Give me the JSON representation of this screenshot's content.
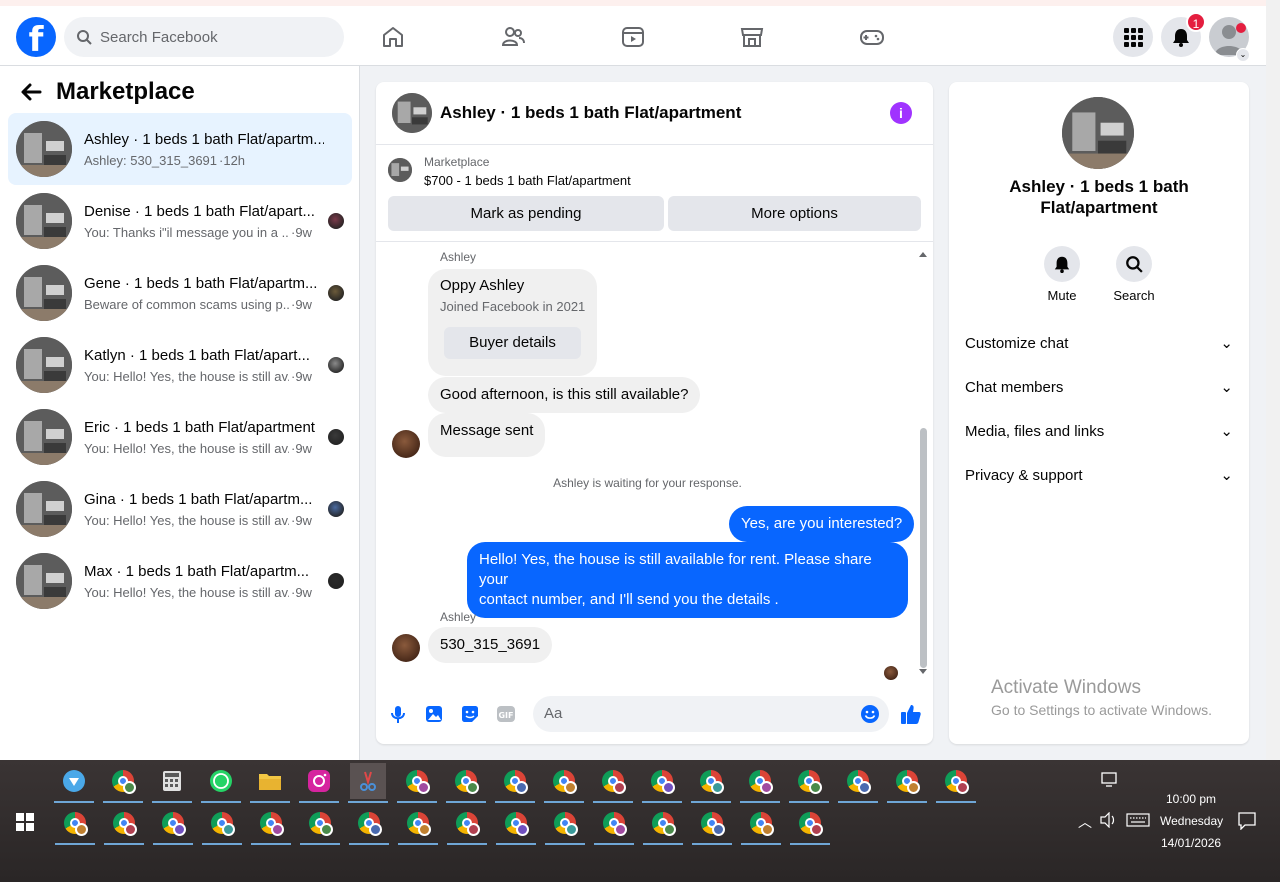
{
  "topbar": {
    "search_placeholder": "Search Facebook",
    "notification_count": "1"
  },
  "sidebar": {
    "title": "Marketplace",
    "conversations": [
      {
        "name": "Ashley · 1 beds 1 bath Flat/apartm...",
        "preview": "Ashley: 530_315_3691",
        "time": "·12h",
        "active": true
      },
      {
        "name": "Denise · 1 beds 1 bath Flat/apart...",
        "preview": "You: Thanks i\"il message you in a ...",
        "time": "·9w"
      },
      {
        "name": "Gene · 1 beds 1 bath Flat/apartm...",
        "preview": "Beware of common scams using p...",
        "time": "·9w"
      },
      {
        "name": "Katlyn · 1 beds 1 bath Flat/apart...",
        "preview": "You: Hello! Yes, the house is still av...",
        "time": "·9w"
      },
      {
        "name": "Eric · 1 beds 1 bath Flat/apartment",
        "preview": "You: Hello! Yes, the house is still av...",
        "time": "·9w"
      },
      {
        "name": "Gina · 1 beds 1 bath Flat/apartm...",
        "preview": "You: Hello! Yes, the house is still av...",
        "time": "·9w"
      },
      {
        "name": "Max · 1 beds 1 bath Flat/apartm...",
        "preview": "You: Hello! Yes, the house is still av...",
        "time": "·9w"
      }
    ]
  },
  "chat": {
    "title": "Ashley · 1 beds 1 bath Flat/apartment",
    "listing_source": "Marketplace",
    "listing_price": "$700 - 1 beds 1 bath Flat/apartment",
    "mark_pending": "Mark as pending",
    "more_options": "More options",
    "sender_name": "Ashley",
    "profile_name": "Oppy Ashley",
    "joined": "Joined Facebook in 2021",
    "buyer_details": "Buyer details",
    "msg_availability": "Good afternoon, is this still available?",
    "msg_sent": "Message sent",
    "waiting": "Ashley is waiting for your response.",
    "reply1": "Yes, are you interested?",
    "reply2_line1": "Hello! Yes, the house is still available for rent. Please share your",
    "reply2_line2": "contact number, and I'll send you the details .",
    "sender_name2": "Ashley",
    "msg_phone": "530_315_3691",
    "composer_placeholder": "Aa"
  },
  "info_panel": {
    "name_line1": "Ashley · 1 beds 1 bath",
    "name_line2": "Flat/apartment",
    "mute": "Mute",
    "search": "Search",
    "sections": [
      "Customize chat",
      "Chat members",
      "Media, files and links",
      "Privacy & support"
    ]
  },
  "watermark": {
    "line1": "Activate Windows",
    "line2": "Go to Settings to activate Windows."
  },
  "taskbar": {
    "time": "10:00 pm",
    "day": "Wednesday",
    "date": "14/01/2026"
  }
}
